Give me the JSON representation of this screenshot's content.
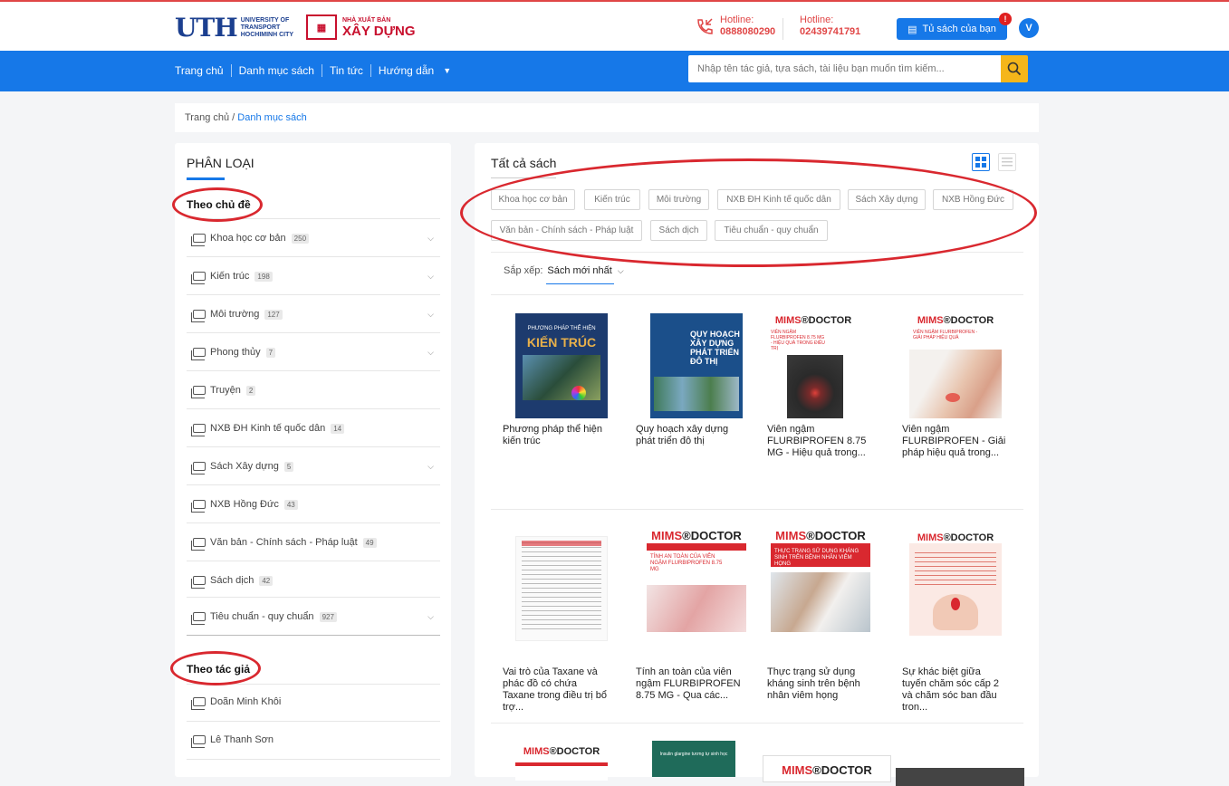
{
  "header": {
    "uth_logo": {
      "big": "UTH",
      "small": "UNIVERSITY OF TRANSPORT HOCHIMINH CITY"
    },
    "nxb_logo": {
      "small": "NHÀ XUẤT BẢN",
      "big": "XÂY DỰNG"
    },
    "hotlines": [
      {
        "label": "Hotline:",
        "number": "0888080290"
      },
      {
        "label": "Hotline:",
        "number": "02439741791"
      }
    ],
    "shelf_button": "Tủ sách của bạn",
    "shelf_badge": "!",
    "avatar_letter": "V"
  },
  "nav": {
    "items": [
      "Trang chủ",
      "Danh mục sách",
      "Tin tức",
      "Hướng dẫn"
    ],
    "search_placeholder": "Nhập tên tác giả, tựa sách, tài liệu bạn muốn tìm kiếm..."
  },
  "breadcrumb": {
    "home": "Trang chủ",
    "sep": " / ",
    "current": "Danh mục sách"
  },
  "sidebar": {
    "title": "PHÂN LOẠI",
    "topic_title": "Theo chủ đề",
    "categories": [
      {
        "label": "Khoa học cơ bản",
        "count": "250",
        "expandable": true
      },
      {
        "label": "Kiến trúc",
        "count": "198",
        "expandable": true
      },
      {
        "label": "Môi trường",
        "count": "127",
        "expandable": true
      },
      {
        "label": "Phong thủy",
        "count": "7",
        "expandable": true
      },
      {
        "label": "Truyện",
        "count": "2",
        "expandable": false
      },
      {
        "label": "NXB ĐH Kinh tế quốc dân",
        "count": "14",
        "expandable": false
      },
      {
        "label": "Sách Xây dựng",
        "count": "5",
        "expandable": true
      },
      {
        "label": "NXB Hồng Đức",
        "count": "43",
        "expandable": false
      },
      {
        "label": "Văn bản - Chính sách - Pháp luật",
        "count": "49",
        "expandable": false
      },
      {
        "label": "Sách dịch",
        "count": "42",
        "expandable": false
      },
      {
        "label": "Tiêu chuẩn - quy chuẩn",
        "count": "927",
        "expandable": true
      }
    ],
    "author_title": "Theo tác giả",
    "authors": [
      "Doãn Minh Khôi",
      "Lê Thanh Sơn"
    ]
  },
  "main": {
    "title": "Tất cả sách",
    "tags": [
      "Khoa học cơ bản",
      "Kiến trúc",
      "Môi trường",
      "NXB ĐH Kinh tế quốc dân",
      "Sách Xây dựng",
      "NXB Hồng Đức",
      "Văn bản - Chính sách - Pháp luật",
      "Sách dịch",
      "Tiêu chuẩn - quy chuẩn"
    ],
    "sort_label": "Sắp xếp:",
    "sort_value": "Sách mới nhất",
    "books": [
      {
        "title": "Phương pháp thể hiện kiến trúc",
        "cover_text": "PHƯƠNG PHÁP THỂ HIỆN KIẾN TRÚC"
      },
      {
        "title": "Quy hoạch xây dựng phát triển đô thị",
        "cover_text": "QUY HOẠCH XÂY DỰNG PHÁT TRIỂN ĐÔ THỊ"
      },
      {
        "title": "Viên ngậm FLURBIPROFEN 8.75 MG - Hiệu quả trong...",
        "cover_text": "MIMS DOCTOR"
      },
      {
        "title": "Viên ngậm FLURBIPROFEN - Giải pháp hiệu quả trong...",
        "cover_text": "MIMS DOCTOR"
      },
      {
        "title": "Vai trò của Taxane và phác đồ có chứa Taxane trong điều trị bổ trợ...",
        "cover_text": ""
      },
      {
        "title": "Tính an toàn của viên ngậm FLURBIPROFEN 8.75 MG - Qua các...",
        "cover_text": "MIMS DOCTOR"
      },
      {
        "title": "Thực trạng sử dụng kháng sinh trên bệnh nhân viêm họng",
        "cover_text": "MIMS DOCTOR"
      },
      {
        "title": "Sự khác biệt giữa tuyến chăm sóc cấp 2 và chăm sóc ban đầu tron...",
        "cover_text": "MIMS DOCTOR"
      }
    ]
  }
}
